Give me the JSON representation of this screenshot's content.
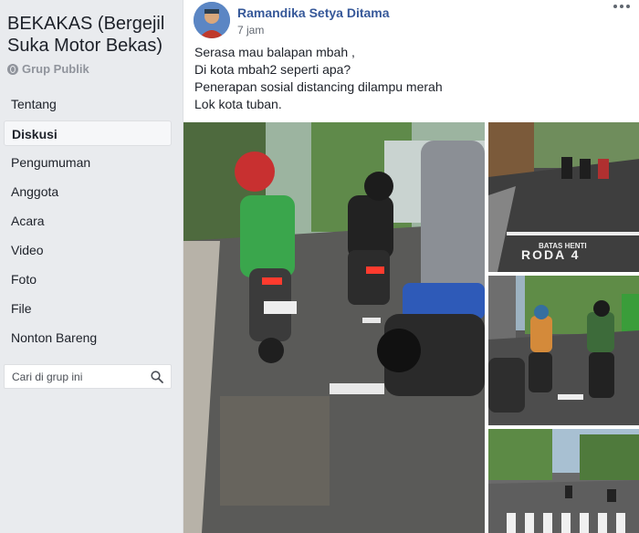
{
  "group": {
    "title": "BEKAKAS (Bergejil Suka Motor Bekas)",
    "privacy": "Grup Publik"
  },
  "nav": {
    "items": [
      {
        "label": "Tentang"
      },
      {
        "label": "Diskusi"
      },
      {
        "label": "Pengumuman"
      },
      {
        "label": "Anggota"
      },
      {
        "label": "Acara"
      },
      {
        "label": "Video"
      },
      {
        "label": "Foto"
      },
      {
        "label": "File"
      },
      {
        "label": "Nonton Bareng"
      }
    ],
    "active": "Diskusi"
  },
  "search": {
    "placeholder": "Cari di grup ini",
    "value": ""
  },
  "post": {
    "author": "Ramandika Setya Ditama",
    "time": "7 jam",
    "lines": [
      "Serasa mau balapan mbah ,",
      "Di kota mbah2 seperti apa?",
      "Penerapan sosial distancing dilampu merah",
      "Lok kota tuban."
    ],
    "photo_text": {
      "road_marking_top": "BATAS HENTI",
      "road_marking_main": "RODA 4"
    }
  },
  "colors": {
    "link": "#365899",
    "page_bg": "#e9ebee",
    "muted": "#90949c"
  },
  "icons": [
    "globe-icon",
    "search-icon",
    "more-icon"
  ]
}
